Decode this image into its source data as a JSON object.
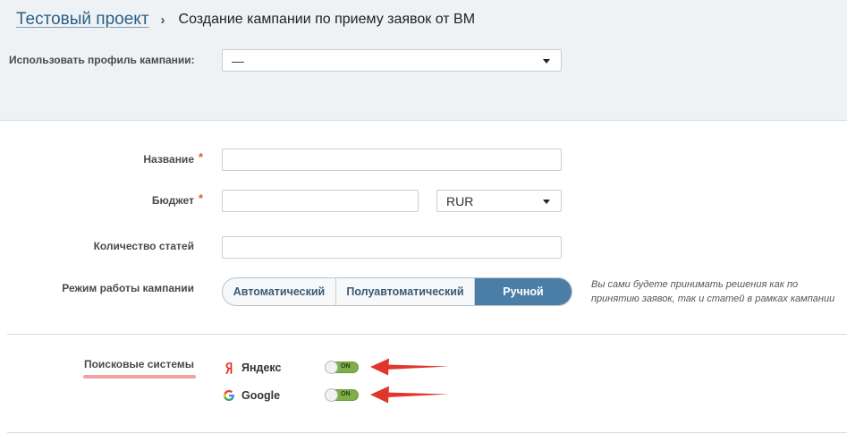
{
  "breadcrumb": {
    "project": "Тестовый проект",
    "separator": "›",
    "current": "Создание кампании по приему заявок от ВМ"
  },
  "profile": {
    "label": "Использовать профиль кампании:",
    "value": "—"
  },
  "form": {
    "name_label": "Название",
    "budget_label": "Бюджет",
    "currency_value": "RUR",
    "articles_label": "Количество статей",
    "mode_label": "Режим работы кампании",
    "required_mark": "*",
    "modes": [
      {
        "label": "Автоматический",
        "active": false
      },
      {
        "label": "Полуавтоматический",
        "active": false
      },
      {
        "label": "Ручной",
        "active": true
      }
    ],
    "mode_hint": "Вы сами будете принимать решения как по принятию заявок, так и статей в рамках кампании"
  },
  "search_engines": {
    "label": "Поисковые системы",
    "items": [
      {
        "name": "Яндекс",
        "icon": "yandex-logo-icon",
        "toggle_text": "ON",
        "enabled": true
      },
      {
        "name": "Google",
        "icon": "google-logo-icon",
        "toggle_text": "ON",
        "enabled": true
      }
    ]
  },
  "colors": {
    "accent": "#4b7ea6",
    "required": "#e4572e",
    "toggle_on": "#7faf4a",
    "annotation_arrow": "#e0362c",
    "annotation_underline": "#f2a0a0"
  }
}
